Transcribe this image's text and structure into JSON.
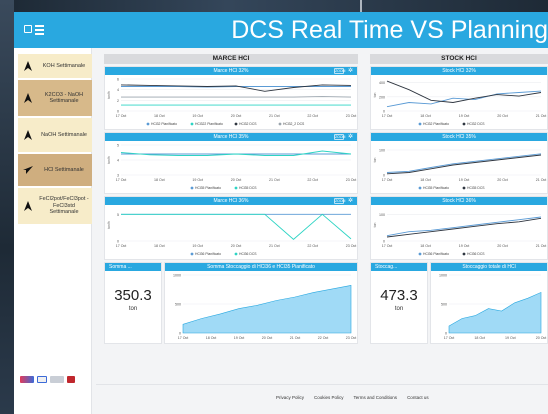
{
  "app": {
    "title": "DCS Real Time VS Planning"
  },
  "sidebar": {
    "items": [
      {
        "label": "KOH Settimanale",
        "style": "alt",
        "icon": "navigation-arrow-icon"
      },
      {
        "label": "K2CO3 - NaOH Settimanale",
        "style": "dark",
        "icon": "navigation-arrow-icon"
      },
      {
        "label": "NaOH Settimanale",
        "style": "alt",
        "icon": "navigation-arrow-icon"
      },
      {
        "label": "HCl Settimanale",
        "style": "sel",
        "icon": "navigation-arrow-icon"
      },
      {
        "label": "FeCl2pot/FeCl3pot - FeCl3std Settimanale",
        "style": "alt",
        "icon": "navigation-arrow-icon"
      }
    ]
  },
  "sections": {
    "marce": "MARCE HCl",
    "stock": "STOCK HCl"
  },
  "panels": {
    "marce_32": {
      "title": "Marce HCl 32%",
      "ylabel": "ton/h",
      "legend": [
        "HCl32 Pianificato",
        "HCl322 Pianificato",
        "HCl32 DCS",
        "HCl32_2 DCS"
      ]
    },
    "marce_35": {
      "title": "Marce HCl 35%",
      "ylabel": "ton/h",
      "legend": [
        "HCl35 Pianificato",
        "HCl35 DCS"
      ]
    },
    "marce_36": {
      "title": "Marce HCl 36%",
      "ylabel": "ton/h",
      "legend": [
        "HCl36 Pianificato",
        "HCl36 DCS"
      ]
    },
    "stock_32": {
      "title": "Stock HCl 32%",
      "ylabel": "ton",
      "legend": [
        "HCl32 Pianificato",
        "HCl32 DCS"
      ]
    },
    "stock_35": {
      "title": "Stock HCl 35%",
      "ylabel": "ton",
      "legend": [
        "HCl35 Pianificato",
        "HCl35 DCS"
      ]
    },
    "stock_36": {
      "title": "Stock HCl 36%",
      "ylabel": "ton",
      "legend": [
        "HCl36 Pianificato",
        "HCl36 DCS"
      ]
    }
  },
  "summaries": {
    "marce": {
      "title": "Somma ...",
      "value": "350.3",
      "unit": "ton",
      "chart_title": "Somma Stoccaggio di HCl36 e HCl35 Pianificato"
    },
    "stock": {
      "title": "Stoccag...",
      "value": "473.3",
      "unit": "ton",
      "chart_title": "Stoccaggio totale di HCl"
    }
  },
  "tools": {
    "zoom_label": "ZOOM"
  },
  "footer": {
    "links": [
      "Privacy Policy",
      "Cookies Policy",
      "Terms and Conditions",
      "Contact us"
    ]
  },
  "colors": {
    "accent": "#29a8e0",
    "planned": "#5b9bd5",
    "planned_alt": "#2dd4c4",
    "dcs": "#2f3640",
    "dcs_alt": "#9aa4ad",
    "area": "#8fd3f4"
  },
  "chart_data": [
    {
      "id": "marce_32",
      "type": "line",
      "title": "Marce HCl 32%",
      "ylabel": "ton/h",
      "x": [
        "17 Oct",
        "18 Oct",
        "19 Oct",
        "20 Oct",
        "21 Oct",
        "22 Oct",
        "23 Oct"
      ],
      "yticks": [
        0,
        2,
        4,
        6
      ],
      "ylim": [
        0,
        6
      ],
      "series": [
        {
          "name": "HCl32 Pianificato",
          "values": [
            4.6,
            4.6,
            4.6,
            4.5,
            4.6,
            4.6,
            4.6,
            4.6,
            4.6
          ]
        },
        {
          "name": "HCl322 Pianificato",
          "values": [
            1.1,
            1.1,
            1.1,
            1.1,
            1.1,
            1.1,
            1.1,
            1.1,
            1.1
          ]
        },
        {
          "name": "HCl32 DCS",
          "values": [
            4.9,
            4.8,
            4.7,
            4.6,
            4.7,
            3.7,
            4.4,
            4.9,
            4.8
          ]
        },
        {
          "name": "HCl32_2 DCS",
          "values": [
            2.6,
            2.6,
            2.6,
            2.6,
            2.6,
            2.6,
            2.6,
            2.7,
            2.6
          ]
        }
      ]
    },
    {
      "id": "marce_35",
      "type": "line",
      "title": "Marce HCl 35%",
      "ylabel": "ton/h",
      "x": [
        "17 Oct",
        "18 Oct",
        "19 Oct",
        "20 Oct",
        "21 Oct",
        "22 Oct",
        "23 Oct"
      ],
      "yticks": [
        3,
        4,
        5
      ],
      "ylim": [
        3,
        5
      ],
      "series": [
        {
          "name": "HCl35 Pianificato",
          "values": [
            4.4,
            4.4,
            4.4,
            4.4,
            4.4,
            4.4,
            4.4,
            4.4,
            4.4
          ]
        },
        {
          "name": "HCl35 DCS",
          "values": [
            4.5,
            4.35,
            4.3,
            4.3,
            4.4,
            4.3,
            4.3,
            4.6,
            4.4
          ]
        }
      ]
    },
    {
      "id": "marce_36",
      "type": "line",
      "title": "Marce HCl 36%",
      "ylabel": "ton/h",
      "x": [
        "17 Oct",
        "18 Oct",
        "19 Oct",
        "20 Oct",
        "21 Oct",
        "22 Oct",
        "23 Oct"
      ],
      "yticks": [
        0,
        5
      ],
      "ylim": [
        0,
        6
      ],
      "series": [
        {
          "name": "HCl36 Pianificato",
          "values": [
            5,
            5,
            5,
            5,
            5,
            5,
            5,
            5,
            5
          ]
        },
        {
          "name": "HCl36 DCS",
          "values": [
            5,
            5,
            5,
            5,
            5,
            5,
            0.3,
            5,
            0.4
          ]
        }
      ]
    },
    {
      "id": "stock_32",
      "type": "line",
      "title": "Stock HCl 32%",
      "ylabel": "ton",
      "x": [
        "17 Oct",
        "18 Oct",
        "19 Oct",
        "20 Oct",
        "21 Oct"
      ],
      "yticks": [
        0,
        200,
        400
      ],
      "ylim": [
        0,
        450
      ],
      "series": [
        {
          "name": "HCl32 Pianificato",
          "values": [
            60,
            120,
            100,
            180,
            160,
            240,
            260,
            280
          ]
        },
        {
          "name": "HCl32 DCS",
          "values": [
            420,
            300,
            150,
            120,
            180,
            230,
            210,
            260
          ]
        }
      ]
    },
    {
      "id": "stock_35",
      "type": "line",
      "title": "Stock HCl 35%",
      "ylabel": "ton",
      "x": [
        "17 Oct",
        "18 Oct",
        "19 Oct",
        "20 Oct",
        "21 Oct"
      ],
      "yticks": [
        0,
        100
      ],
      "ylim": [
        0,
        120
      ],
      "series": [
        {
          "name": "HCl35 Pianificato",
          "values": [
            10,
            15,
            30,
            45,
            55,
            65,
            75,
            85
          ]
        },
        {
          "name": "HCl35 DCS",
          "values": [
            5,
            10,
            25,
            40,
            50,
            60,
            70,
            80
          ]
        }
      ]
    },
    {
      "id": "stock_36",
      "type": "line",
      "title": "Stock HCl 36%",
      "ylabel": "ton",
      "x": [
        "17 Oct",
        "18 Oct",
        "19 Oct",
        "20 Oct",
        "21 Oct"
      ],
      "yticks": [
        0,
        100
      ],
      "ylim": [
        0,
        120
      ],
      "series": [
        {
          "name": "HCl36 Pianificato",
          "values": [
            20,
            35,
            40,
            50,
            60,
            70,
            80,
            90
          ]
        },
        {
          "name": "HCl36 DCS",
          "values": [
            15,
            25,
            35,
            45,
            55,
            65,
            72,
            85
          ]
        }
      ]
    },
    {
      "id": "somma",
      "type": "area",
      "title": "Somma Stoccaggio di HCl36 e HCl35 Pianificato",
      "x": [
        "17 Oct",
        "18 Oct",
        "19 Oct",
        "20 Oct",
        "21 Oct",
        "22 Oct",
        "23 Oct"
      ],
      "yticks": [
        0,
        500,
        1000
      ],
      "ylim": [
        0,
        1000
      ],
      "series": [
        {
          "name": "",
          "values": [
            150,
            250,
            330,
            420,
            480,
            560,
            620,
            700,
            760,
            820
          ]
        }
      ]
    },
    {
      "id": "stoccaggio",
      "type": "area",
      "title": "Stoccaggio totale di HCl",
      "x": [
        "17 Oct",
        "18 Oct",
        "19 Oct",
        "20 Oct"
      ],
      "yticks": [
        0,
        500,
        1000
      ],
      "ylim": [
        0,
        1000
      ],
      "series": [
        {
          "name": "",
          "values": [
            120,
            250,
            300,
            420,
            380,
            520,
            600,
            700
          ]
        }
      ]
    }
  ]
}
